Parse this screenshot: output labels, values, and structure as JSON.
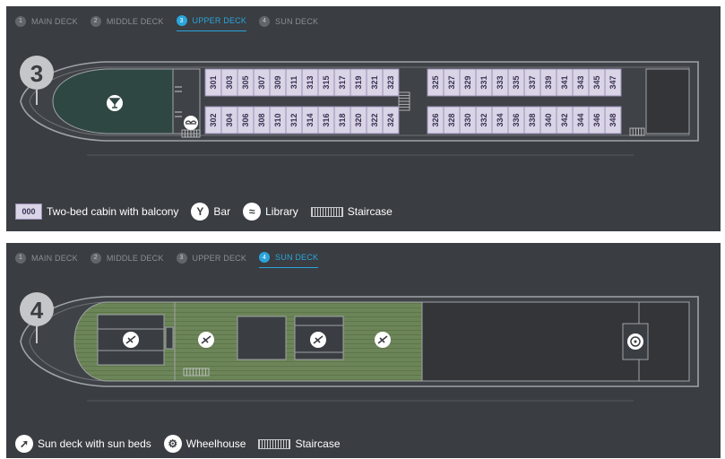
{
  "upper": {
    "tabs": [
      {
        "num": "1",
        "label": "MAIN DECK",
        "active": false
      },
      {
        "num": "2",
        "label": "MIDDLE DECK",
        "active": false
      },
      {
        "num": "3",
        "label": "UPPER DECK",
        "active": true
      },
      {
        "num": "4",
        "label": "SUN DECK",
        "active": false
      }
    ],
    "deck_number": "3",
    "top_cabins": [
      "301",
      "303",
      "305",
      "307",
      "309",
      "311",
      "313",
      "315",
      "317",
      "319",
      "321",
      "323",
      "325",
      "327",
      "329",
      "331",
      "333",
      "335",
      "337",
      "339",
      "341",
      "343",
      "345",
      "347"
    ],
    "bottom_cabins": [
      "302",
      "304",
      "306",
      "308",
      "310",
      "312",
      "314",
      "316",
      "318",
      "320",
      "322",
      "324",
      "326",
      "328",
      "330",
      "332",
      "334",
      "336",
      "338",
      "340",
      "342",
      "344",
      "346",
      "348"
    ],
    "legend": {
      "cabin_code": "000",
      "cabin_label": "Two-bed cabin with balcony",
      "bar_label": "Bar",
      "library_label": "Library",
      "stair_label": "Staircase"
    }
  },
  "sun": {
    "tabs": [
      {
        "num": "1",
        "label": "MAIN DECK",
        "active": false
      },
      {
        "num": "2",
        "label": "MIDDLE DECK",
        "active": false
      },
      {
        "num": "3",
        "label": "UPPER DECK",
        "active": false
      },
      {
        "num": "4",
        "label": "SUN DECK",
        "active": true
      }
    ],
    "deck_number": "4",
    "legend": {
      "sunbed_label": "Sun deck with sun beds",
      "wheelhouse_label": "Wheelhouse",
      "stair_label": "Staircase"
    }
  },
  "colors": {
    "panel": "#3a3d41",
    "accent": "#2aa5dc",
    "cabin_fill": "#d9d4e6",
    "cabin_border": "#9a8fb5",
    "lounge": "#2f4743",
    "sun_deck": "#6c8558"
  },
  "icons": {
    "bar": "cocktail-glass-icon",
    "library": "open-book-icon",
    "sunbed": "sunbed-icon",
    "wheelhouse": "ship-wheel-icon",
    "stair": "staircase-icon"
  }
}
